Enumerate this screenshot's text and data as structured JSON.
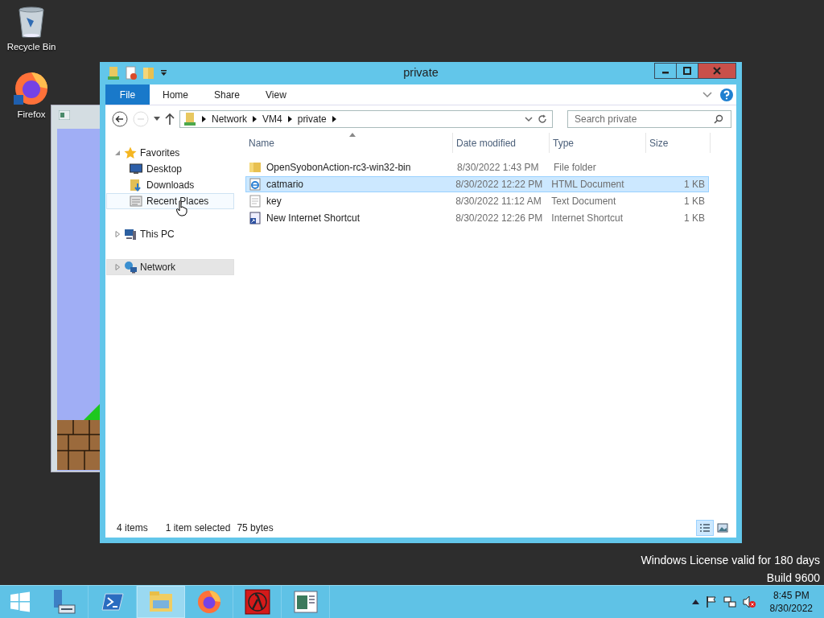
{
  "desktop_icons": [
    {
      "label": "Recycle Bin",
      "kind": "recycle"
    },
    {
      "label": "Firefox",
      "kind": "firefox"
    }
  ],
  "window": {
    "title": "private"
  },
  "ribbon_tabs": [
    {
      "label": "File",
      "kind": "file"
    },
    {
      "label": "Home",
      "kind": "tab"
    },
    {
      "label": "Share",
      "kind": "tab"
    },
    {
      "label": "View",
      "kind": "tab"
    }
  ],
  "address": {
    "crumbs": [
      "Network",
      "VM4",
      "private"
    ]
  },
  "search": {
    "placeholder": "Search private"
  },
  "nav": [
    {
      "label": "Favorites",
      "kind": "favorites",
      "expanded": true,
      "selected": false,
      "hovered": false,
      "children": [
        {
          "label": "Desktop",
          "kind": "desktop",
          "selected": false,
          "hovered": false
        },
        {
          "label": "Downloads",
          "kind": "downloads",
          "selected": false,
          "hovered": false
        },
        {
          "label": "Recent Places",
          "kind": "recent",
          "selected": false,
          "hovered": true
        }
      ]
    },
    {
      "label": "This PC",
      "kind": "pc",
      "expanded": false,
      "selected": false,
      "hovered": false
    },
    {
      "label": "Network",
      "kind": "network",
      "expanded": false,
      "selected": true,
      "hovered": false
    }
  ],
  "columns": [
    {
      "label": "Name",
      "sorted": true
    },
    {
      "label": "Date modified",
      "sorted": false
    },
    {
      "label": "Type",
      "sorted": false
    },
    {
      "label": "Size",
      "sorted": false
    }
  ],
  "rows": [
    {
      "name": "OpenSyobonAction-rc3-win32-bin",
      "date": "8/30/2022 1:43 PM",
      "type": "File folder",
      "kind": "folder",
      "selected": false
    },
    {
      "name": "catmario",
      "date": "8/30/2022 12:22 PM",
      "type": "HTML Document",
      "size": "1 KB",
      "kind": "html",
      "selected": true
    },
    {
      "name": "key",
      "date": "8/30/2022 11:12 AM",
      "type": "Text Document",
      "size": "1 KB",
      "kind": "text",
      "selected": false
    },
    {
      "name": "New Internet Shortcut",
      "date": "8/30/2022 12:26 PM",
      "type": "Internet Shortcut",
      "size": "1 KB",
      "kind": "shortcut",
      "selected": false
    }
  ],
  "status_bar": {
    "count": "4 items",
    "selection": "1 item selected",
    "size": "75 bytes"
  },
  "view_buttons": [
    {
      "kind": "details",
      "selected": true
    },
    {
      "kind": "large",
      "selected": false
    }
  ],
  "watermark": {
    "license": "Windows License valid for 180 days",
    "build": "Build 9600"
  },
  "taskbar": {
    "apps": [
      {
        "kind": "server",
        "active": false
      },
      {
        "kind": "powershell",
        "active": false
      },
      {
        "kind": "explorer",
        "active": true
      },
      {
        "kind": "firefox",
        "active": false
      },
      {
        "kind": "lambda",
        "active": false
      },
      {
        "kind": "window",
        "active": false
      }
    ],
    "time": "8:45 PM",
    "date": "8/30/2022"
  }
}
